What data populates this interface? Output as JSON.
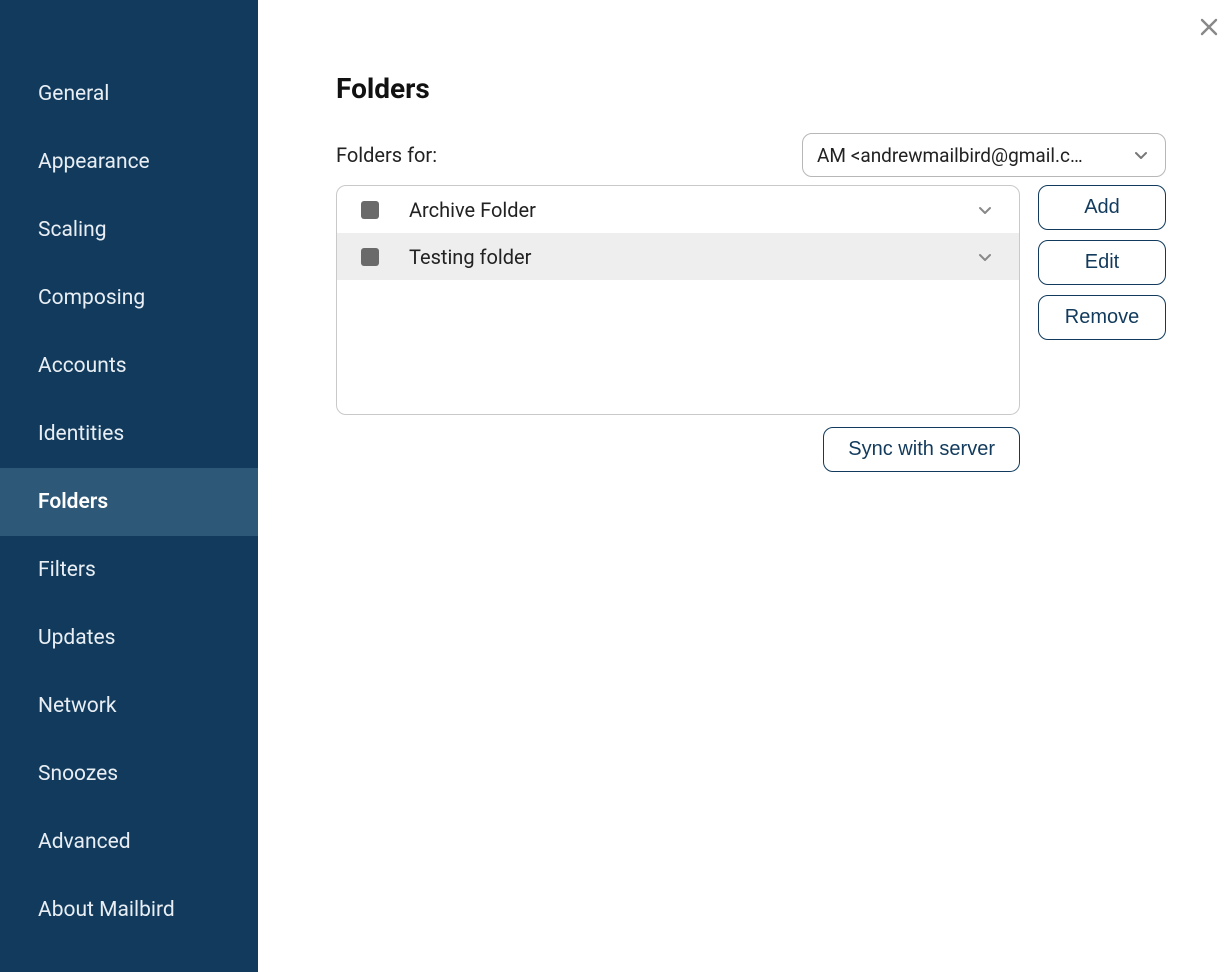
{
  "sidebar": {
    "items": [
      {
        "label": "General",
        "active": false
      },
      {
        "label": "Appearance",
        "active": false
      },
      {
        "label": "Scaling",
        "active": false
      },
      {
        "label": "Composing",
        "active": false
      },
      {
        "label": "Accounts",
        "active": false
      },
      {
        "label": "Identities",
        "active": false
      },
      {
        "label": "Folders",
        "active": true
      },
      {
        "label": "Filters",
        "active": false
      },
      {
        "label": "Updates",
        "active": false
      },
      {
        "label": "Network",
        "active": false
      },
      {
        "label": "Snoozes",
        "active": false
      },
      {
        "label": "Advanced",
        "active": false
      },
      {
        "label": "About Mailbird",
        "active": false
      }
    ]
  },
  "main": {
    "title": "Folders",
    "folders_for_label": "Folders for:",
    "account_selected": "AM <andrewmailbird@gmail.c…",
    "folders": [
      {
        "name": "Archive Folder",
        "selected": false
      },
      {
        "name": "Testing folder",
        "selected": true
      }
    ],
    "buttons": {
      "add": "Add",
      "edit": "Edit",
      "remove": "Remove",
      "sync": "Sync with server"
    }
  }
}
